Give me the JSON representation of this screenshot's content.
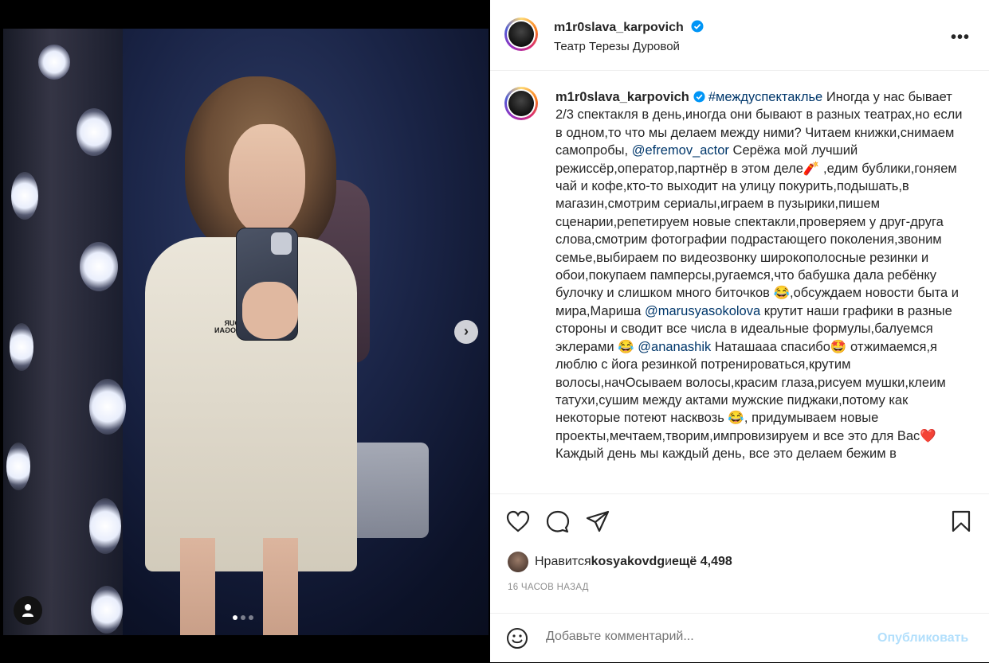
{
  "post": {
    "username": "m1r0slava_karpovich",
    "location": "Театр Терезы Дуровой",
    "shirt_text_lines": [
      "YOUR",
      "SLOGAN"
    ]
  },
  "caption": {
    "username": "m1r0slava_karpovich",
    "hashtag": "#междуспектакльe",
    "part1": " Иногда у нас бывает 2/3 спектакля в день,иногда они бывают в разных театрах,но если в одном,то что мы делаем между ними? Читаем книжки,снимаем самопробы, ",
    "mention1": "@efremov_actor",
    "part2": " Серёжа мой лучший режиссёр,оператор,партнёр в этом деле🧨 ,едим бублики,гоняем чай и кофе,кто-то выходит на улицу покурить,подышать,в магазин,смотрим сериалы,играем в пузырики,пишем сценарии,репетируем новые спектакли,проверяем у друг-друга слова,смотрим фотографии подрастающего поколения,звоним семье,выбираем по видеозвонку широкополосные резинки и обои,покупаем памперсы,ругаемся,что бабушка дала ребёнку булочку и слишком много биточков 😂,обсуждаем новости быта и мира,Мариша ",
    "mention2": "@marusyasokolova",
    "part3": " крутит наши графики в разные стороны и сводит все числа в идеальные формулы,балуемся эклерами 😂 ",
    "mention3": "@ananashik",
    "part4": " Наташааа спасибо🤩 отжимаемся,я люблю с йога резинкой потренироваться,крутим волосы,начОсываем волосы,красим глаза,рисуем мушки,клеим татухи,сушим между актами мужские пиджаки,потому как некоторые потеют насквозь 😂, придумываем новые проекты,мечтаем,творим,импровизируем и все это для Вас❤️ Каждый день мы каждый день, все это делаем бежим в"
  },
  "likes": {
    "prefix": "Нравится ",
    "user": "kosyakovdg",
    "middle": " и ",
    "count": "ещё 4,498"
  },
  "timestamp": "16 ЧАСОВ НАЗАД",
  "comment": {
    "placeholder": "Добавьте комментарий...",
    "publish_label": "Опубликовать"
  },
  "icons": {
    "next": "chevron-right-icon",
    "tag": "user-tag-icon",
    "verified": "verified-badge-icon",
    "more": "more-horizontal-icon",
    "like": "heart-icon",
    "comment": "comment-icon",
    "share": "send-icon",
    "save": "bookmark-icon",
    "emoji": "emoji-icon"
  },
  "colors": {
    "verified": "#0095f6",
    "link": "#00376b",
    "publish_disabled": "#b2dffc",
    "muted": "#8e8e8e"
  },
  "carousel": {
    "current": 1,
    "total": 3
  }
}
